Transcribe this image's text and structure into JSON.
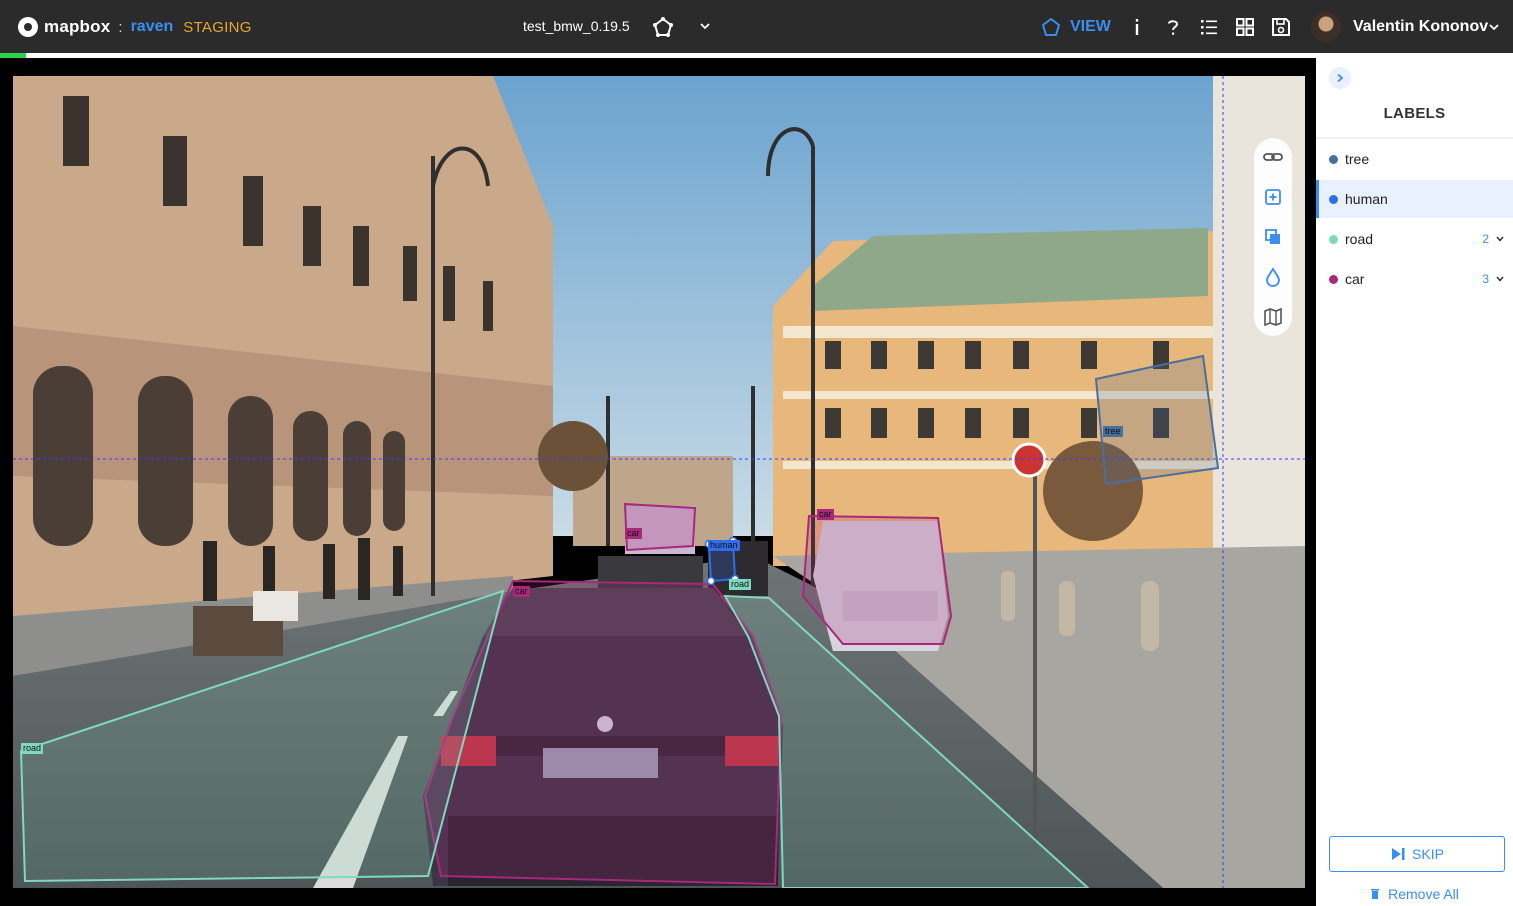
{
  "header": {
    "brand_name": "mapbox",
    "separator": ":",
    "app_name": "raven",
    "environment": "STAGING",
    "project_name": "test_bmw_0.19.5",
    "view_label": "VIEW",
    "info_icon": "info-icon",
    "help_icon": "help-icon",
    "user_name": "Valentin Kononov",
    "progress_fraction": 0.02,
    "colors": {
      "bar_bg": "#2b2b2b",
      "accent": "#3a8ef0",
      "env": "#e8a72c",
      "progress": "#2ed14a"
    }
  },
  "annotations": [
    {
      "label": "car"
    },
    {
      "label": "car"
    },
    {
      "label": "car"
    },
    {
      "label": "human"
    },
    {
      "label": "road"
    },
    {
      "label": "road"
    },
    {
      "label": "tree"
    }
  ],
  "tools": [
    "link-icon",
    "add-shape-icon",
    "duplicate-icon",
    "drop-icon",
    "map-icon"
  ],
  "sidebar": {
    "title": "LABELS",
    "labels": [
      {
        "name": "tree",
        "color": "#4a6f9c",
        "count": ""
      },
      {
        "name": "human",
        "color": "#2f6ee8",
        "count": ""
      },
      {
        "name": "road",
        "color": "#7fd9bf",
        "count": "2"
      },
      {
        "name": "car",
        "color": "#a8287a",
        "count": "3"
      }
    ],
    "skip_label": "SKIP",
    "remove_all_label": "Remove All"
  }
}
